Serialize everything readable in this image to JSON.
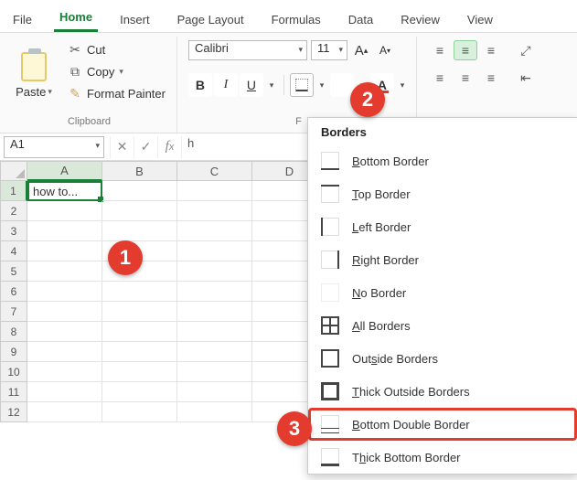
{
  "tabs": {
    "file": "File",
    "home": "Home",
    "insert": "Insert",
    "page_layout": "Page Layout",
    "formulas": "Formulas",
    "data": "Data",
    "review": "Review",
    "view": "View"
  },
  "clipboard": {
    "paste": "Paste",
    "cut": "Cut",
    "copy": "Copy",
    "format_painter": "Format Painter",
    "title": "Clipboard"
  },
  "font": {
    "name": "Calibri",
    "size": "11",
    "title": "F"
  },
  "name_box": "A1",
  "formula_prefix": "h",
  "cell_A1": "how to...",
  "cols": [
    "A",
    "B",
    "C",
    "D"
  ],
  "rows": [
    "1",
    "2",
    "3",
    "4",
    "5",
    "6",
    "7",
    "8",
    "9",
    "10",
    "11",
    "12"
  ],
  "menu": {
    "title": "Borders",
    "items": [
      {
        "accel": "B",
        "rest": "ottom Border"
      },
      {
        "accel": "T",
        "rest": "op Border"
      },
      {
        "accel": "L",
        "rest": "eft Border"
      },
      {
        "accel": "R",
        "rest": "ight Border"
      },
      {
        "accel": "N",
        "rest": "o Border"
      },
      {
        "accel": "A",
        "rest": "ll Borders"
      },
      {
        "accel": "",
        "rest": "Outside Borders"
      },
      {
        "accel": "T",
        "rest": "hick Outside Borders"
      },
      {
        "accel": "B",
        "rest": "ottom Double Border"
      },
      {
        "accel": "",
        "rest": "Thick Bottom Border"
      }
    ]
  },
  "badges": {
    "b1": "1",
    "b2": "2",
    "b3": "3"
  }
}
